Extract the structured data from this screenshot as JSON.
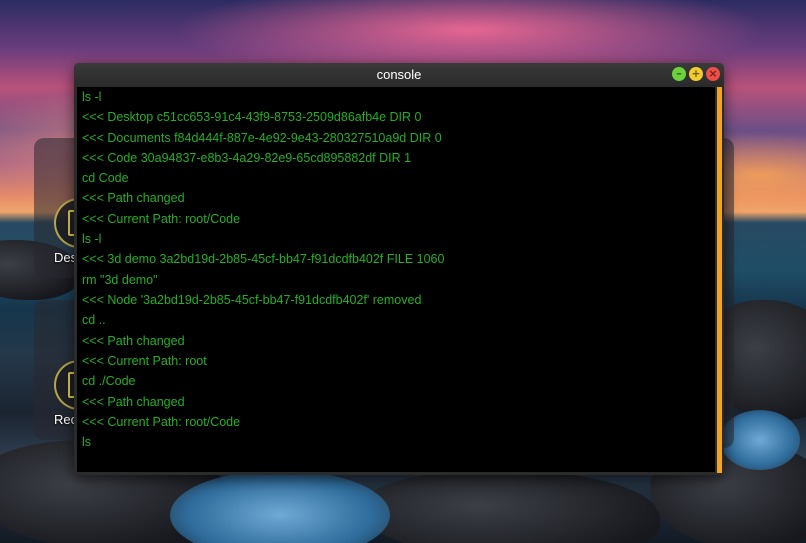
{
  "window": {
    "title": "console",
    "buttons": {
      "minimize": "–",
      "maximize": "+",
      "close": "×"
    }
  },
  "desktop": {
    "icons": [
      {
        "label": "Desk"
      },
      {
        "label": "Recyc"
      }
    ]
  },
  "terminal": {
    "text_color": "#22b022",
    "scrollbar_color": "#f0a524",
    "lines": [
      "ls -l",
      "<<< Desktop c51cc653-91c4-43f9-8753-2509d86afb4e DIR 0",
      "<<< Documents f84d444f-887e-4e92-9e43-280327510a9d DIR 0",
      "<<< Code 30a94837-e8b3-4a29-82e9-65cd895882df DIR 1",
      "cd Code",
      "<<< Path changed",
      "<<< Current Path: root/Code",
      "ls -l",
      "<<< 3d demo 3a2bd19d-2b85-45cf-bb47-f91dcdfb402f FILE 1060",
      "rm \"3d demo\"",
      "<<< Node '3a2bd19d-2b85-45cf-bb47-f91dcdfb402f' removed",
      "cd ..",
      "<<< Path changed",
      "<<< Current Path: root",
      "cd ./Code",
      "<<< Path changed",
      "<<< Current Path: root/Code",
      "ls"
    ]
  }
}
